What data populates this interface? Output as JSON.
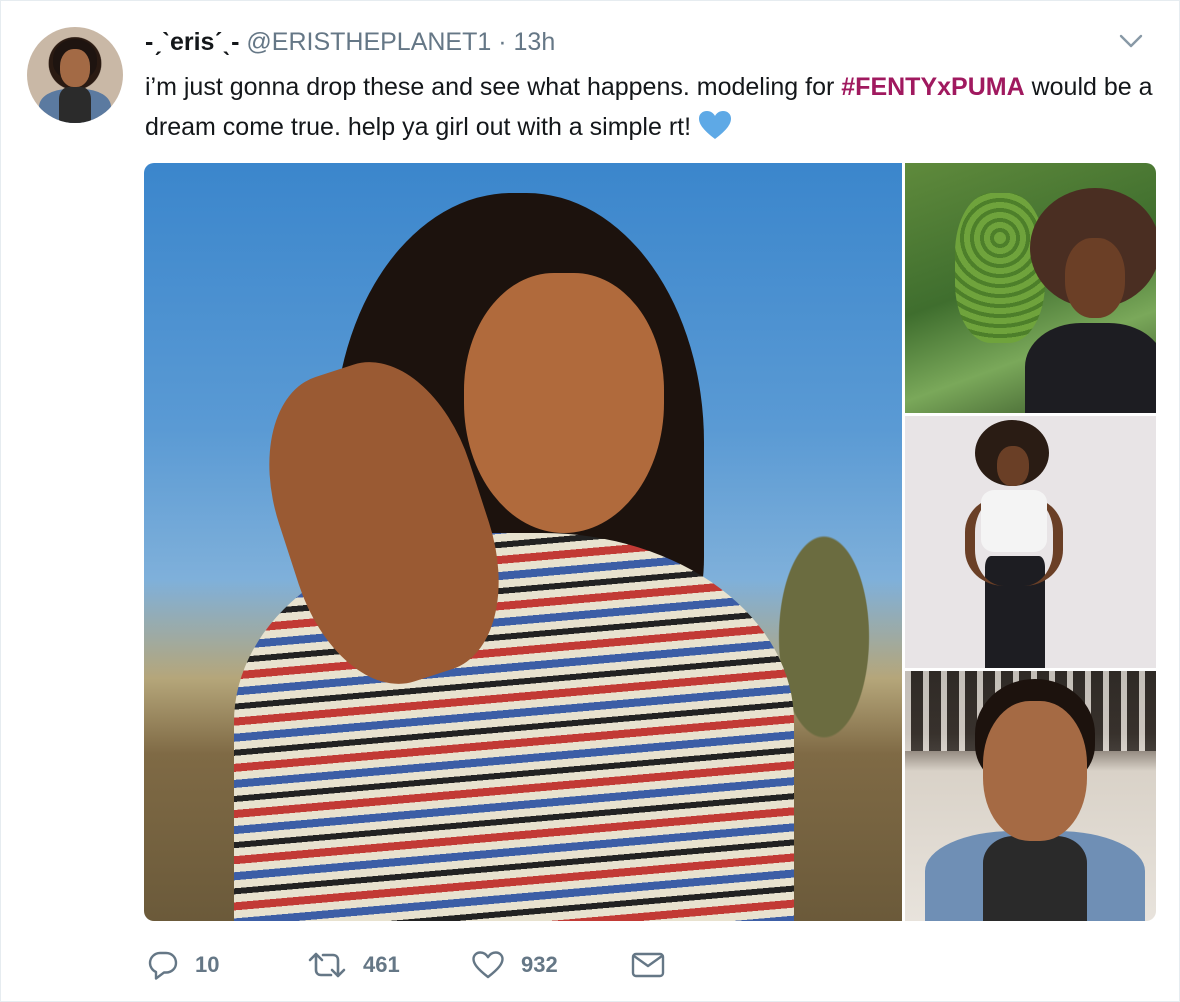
{
  "tweet": {
    "display_name": "-ˏˋerisˊˎ-",
    "handle": "@ERISTHEPLANET1",
    "separator": "·",
    "time": "13h",
    "text_part1": "i’m just gonna drop these and see what happens. modeling for ",
    "hashtag": "#FENTYxPUMA",
    "text_part2": " would be a dream come true. help ya girl out with a simple rt!",
    "emoji": "blue-heart-icon",
    "hashtag_color": "#a0195f",
    "emoji_color": "#5ea9e6"
  },
  "actions": {
    "reply_count": "10",
    "retweet_count": "461",
    "like_count": "932",
    "icons": [
      "reply-icon",
      "retweet-icon",
      "like-heart-icon",
      "direct-message-icon"
    ],
    "icon_color": "#657786"
  },
  "media": {
    "count": 4
  }
}
